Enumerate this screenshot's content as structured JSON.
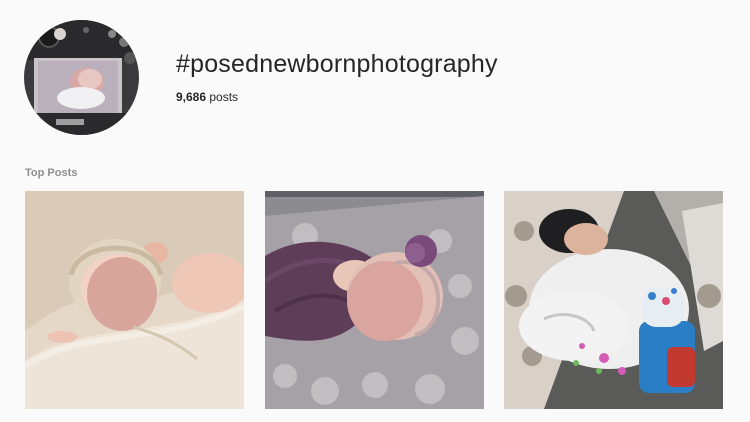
{
  "hashtag": {
    "title": "#posednewbornphotography",
    "post_count": "9,686",
    "post_count_suffix": "posts"
  },
  "sections": {
    "top_posts_label": "Top Posts"
  },
  "posts": [
    {
      "kind": "newborn-in-bonnet-on-cream-blanket"
    },
    {
      "kind": "newborn-in-purple-wrap-on-grey-fur"
    },
    {
      "kind": "newborn-sleeping-with-toy-on-pillow"
    }
  ],
  "avatar": {
    "kind": "camera-screen-newborn-preview"
  },
  "colors": {
    "background": "#fafafa",
    "text_primary": "#262626",
    "text_secondary": "#8e8e8e"
  }
}
